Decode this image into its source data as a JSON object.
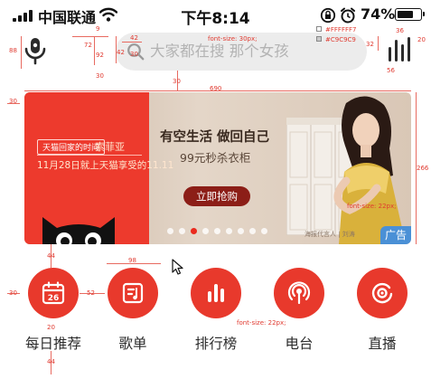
{
  "status_bar": {
    "carrier": "中国联通",
    "time": "下午8:14",
    "battery_percent": "74%",
    "battery_level": 0.74,
    "icons": [
      "signal-icon",
      "wifi-icon",
      "rotation-lock-icon",
      "alarm-icon",
      "battery-icon"
    ]
  },
  "header": {
    "mic_icon": "microphone-icon",
    "search": {
      "icon": "search-icon",
      "placeholder": "大家都在搜 那个女孩"
    },
    "right_icon": "sound-bars-icon"
  },
  "banner": {
    "promo_tag": "天猫回家的时间",
    "brand": "索菲亚",
    "date_line": "11月28日就上天猫享受的11.11",
    "title": "有空生活 做回自己",
    "subtitle": "99元秒杀衣柜",
    "cta_label": "立即抢购",
    "caption": "海报代言人 | 刘涛",
    "ad_label": "广告",
    "slide_count": 9,
    "active_slide": 3
  },
  "entries": [
    {
      "label": "每日推荐",
      "icon": "calendar-26-icon",
      "day": "26"
    },
    {
      "label": "歌单",
      "icon": "playlist-icon"
    },
    {
      "label": "排行榜",
      "icon": "chart-bars-icon"
    },
    {
      "label": "电台",
      "icon": "radio-broadcast-icon"
    },
    {
      "label": "直播",
      "icon": "live-stream-icon"
    }
  ],
  "annotations": {
    "left_88": "88",
    "left_30a": "30",
    "left_30b": "30",
    "mic_gap_42": "42",
    "mic_gap_92": "92",
    "mic_gap_72": "72",
    "mic_30": "30",
    "mic_9": "9",
    "search_42": "42",
    "search_30": "30",
    "search_font": "font-size: 30px;",
    "color_1": "#FFFFFF7",
    "color_2": "#C9C9C9",
    "right_32": "32",
    "right_36": "36",
    "right_20": "20",
    "right_56": "56",
    "banner_30": "30",
    "banner_width": "690",
    "banner_height": "266",
    "banner_font": "font-size: 22px;",
    "icon_98": "98",
    "icon_52": "52",
    "icon_20": "20",
    "icon_44a": "44",
    "icon_44b": "44",
    "label_font": "font-size: 22px;"
  }
}
